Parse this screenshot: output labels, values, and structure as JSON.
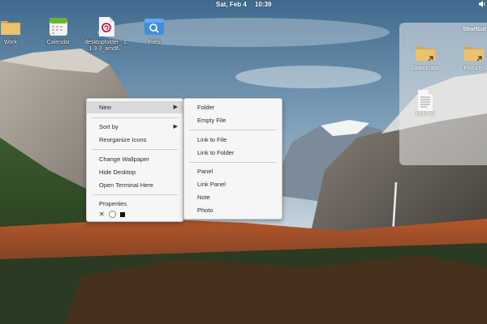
{
  "topbar": {
    "date": "Sat, Feb  4",
    "time": "10:39",
    "volume_icon": "speaker-icon"
  },
  "desktop_icons": [
    {
      "label": "Work",
      "icon": "folder-icon"
    },
    {
      "label": "Calendar",
      "icon": "calendar-icon"
    },
    {
      "label": "desktopfolder_ 1.1.3-3_amd6...",
      "icon": "debian-package-icon"
    },
    {
      "label": "Files",
      "icon": "files-app-icon"
    }
  ],
  "shortcuts_panel": {
    "title": "Shortcut",
    "items": [
      {
        "label": "Downloads",
        "icon": "folder-link-icon"
      },
      {
        "label": "Pictures",
        "icon": "folder-link-icon"
      },
      {
        "label": "todo.txt",
        "icon": "text-file-icon"
      }
    ]
  },
  "context_menu": {
    "items": {
      "new": "New",
      "sort_by": "Sort by",
      "reorganize": "Reorganize Icons",
      "change_wallpaper": "Change Wallpaper",
      "hide_desktop": "Hide Desktop",
      "open_terminal": "Open Terminal Here",
      "properties": "Properties"
    },
    "property_icons": [
      "x-icon",
      "circle-icon",
      "square-icon"
    ]
  },
  "sub_menu": {
    "items": {
      "folder": "Folder",
      "empty_file": "Empty File",
      "link_file": "Link to File",
      "link_folder": "Link to Folder",
      "panel": "Panel",
      "link_panel": "Link Panel",
      "note": "Note",
      "photo": "Photo"
    }
  },
  "colors": {
    "menu_bg": "#f6f6f6",
    "menu_highlight": "#d9d9d9",
    "folder": "#e8bf6a"
  }
}
